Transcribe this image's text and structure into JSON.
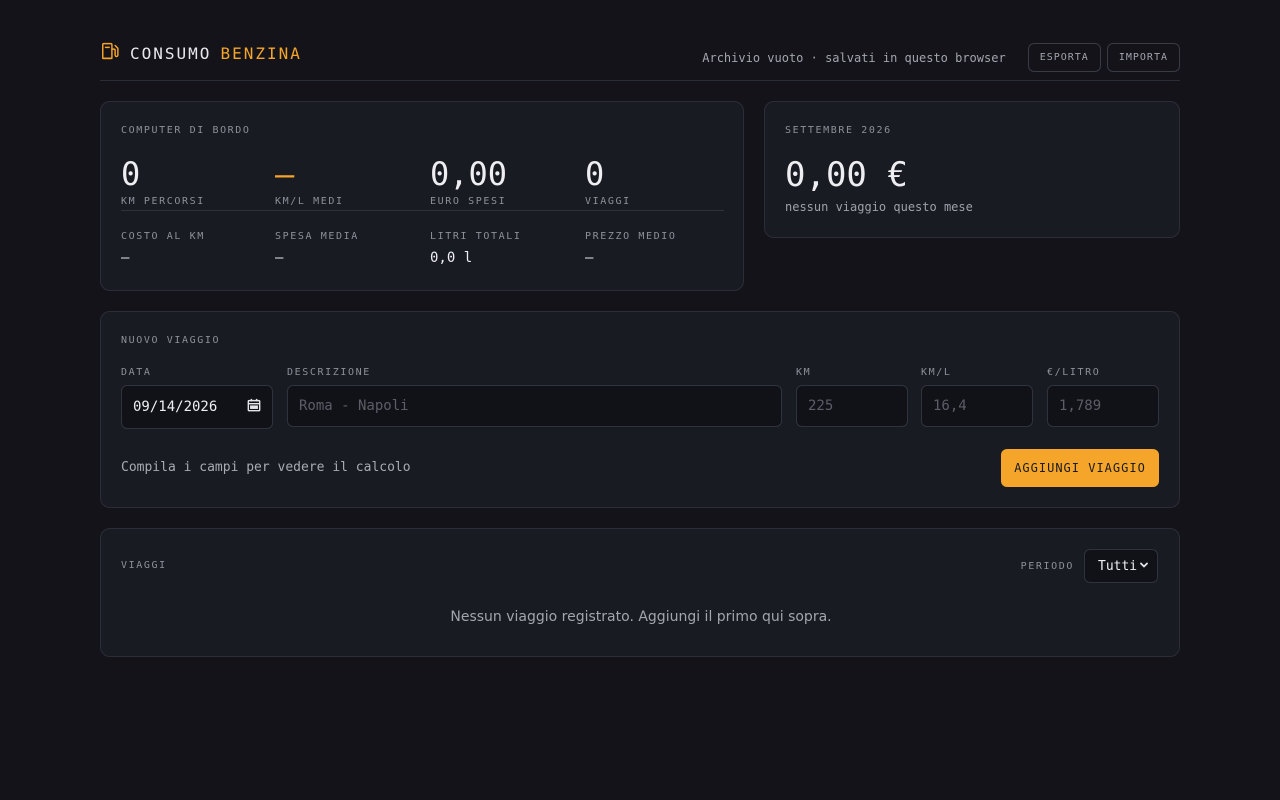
{
  "header": {
    "brand_main": "CONSUMO",
    "brand_accent": "BENZINA",
    "archive_note": "Archivio vuoto · salvati in questo browser",
    "export_label": "ESPORTA",
    "import_label": "IMPORTA"
  },
  "bordo": {
    "title": "COMPUTER DI BORDO",
    "stats": [
      {
        "value": "0",
        "label": "KM PERCORSI"
      },
      {
        "value": "—",
        "label": "KM/L MEDI"
      },
      {
        "value": "0,00",
        "label": "EURO SPESI"
      },
      {
        "value": "0",
        "label": "VIAGGI"
      }
    ],
    "substats": [
      {
        "value": "—",
        "label": "COSTO AL KM"
      },
      {
        "value": "—",
        "label": "SPESA MEDIA"
      },
      {
        "value": "0,0 l",
        "label": "LITRI TOTALI"
      },
      {
        "value": "—",
        "label": "PREZZO MEDIO"
      }
    ]
  },
  "month": {
    "title": "SETTEMBRE 2026",
    "amount": "0,00 €",
    "note": "nessun viaggio questo mese"
  },
  "nuovo": {
    "title": "NUOVO VIAGGIO",
    "date_label": "DATA",
    "date_value": "09/14/2026",
    "desc_label": "DESCRIZIONE",
    "desc_placeholder": "Roma - Napoli",
    "km_label": "KM",
    "km_placeholder": "225",
    "kml_label": "KM/L",
    "kml_placeholder": "16,4",
    "price_label": "€/LITRO",
    "price_placeholder": "1,789",
    "calc_note": "Compila i campi per vedere il calcolo",
    "add_label": "AGGIUNGI VIAGGIO"
  },
  "viaggi": {
    "title": "VIAGGI",
    "period_label": "PERIODO",
    "period_value": "Tutti",
    "empty": "Nessun viaggio registrato. Aggiungi il primo qui sopra."
  },
  "colors": {
    "accent": "#f4a52a",
    "background": "#131319",
    "card": "#191b23"
  }
}
